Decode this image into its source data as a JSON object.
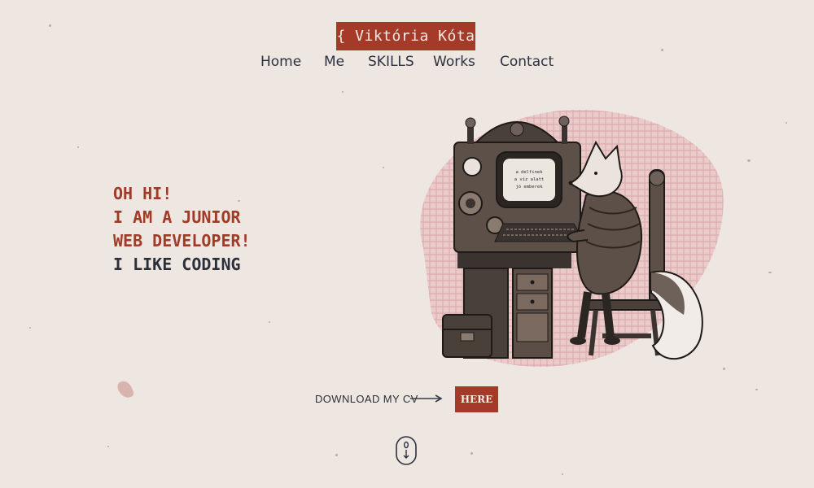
{
  "logo": {
    "text": "{ Viktória Kóta }"
  },
  "nav": {
    "items": [
      {
        "label": "Home"
      },
      {
        "label": "Me"
      },
      {
        "label": "SKILLS"
      },
      {
        "label": "Works"
      },
      {
        "label": "Contact"
      }
    ]
  },
  "hero": {
    "line1": "OH HI!",
    "line2": "I AM A JUNIOR",
    "line3": "WEB DEVELOPER!",
    "line4": "I LIKE CODING"
  },
  "illustration": {
    "screen_line1": "a delfinek",
    "screen_line2": "a víz alatt",
    "screen_line3": "jó emberek"
  },
  "cv": {
    "label": "DOWNLOAD MY CV",
    "button": "HERE"
  },
  "colors": {
    "accent": "#a53a28",
    "text": "#2b2f3a",
    "background": "#ede6e1",
    "blob": "#e8c2c2"
  },
  "icons": {
    "arrow": "long-right-arrow-icon",
    "scroll": "mouse-scroll-icon"
  }
}
